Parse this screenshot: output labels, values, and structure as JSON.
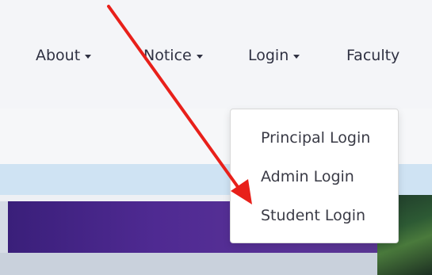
{
  "nav": {
    "items": [
      {
        "label": "About",
        "has_caret": true
      },
      {
        "label": "Notice",
        "has_caret": true
      },
      {
        "label": "Login",
        "has_caret": true
      },
      {
        "label": "Faculty",
        "has_caret": false
      }
    ]
  },
  "login_dropdown": {
    "items": [
      {
        "label": "Principal Login"
      },
      {
        "label": "Admin Login"
      },
      {
        "label": "Student Login"
      }
    ]
  },
  "annotation": {
    "arrow_color": "#e8201a",
    "points_to": "Student Login"
  },
  "colors": {
    "nav_text": "#2f3142",
    "banner_purple": "#4f2a92",
    "banner_light_blue": "#cfe3f3"
  }
}
